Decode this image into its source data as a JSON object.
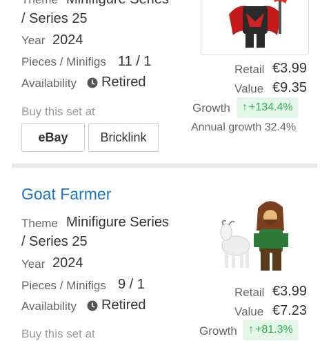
{
  "set1": {
    "theme_label": "Theme",
    "theme_value_line1": "Minifigure Series",
    "theme_value_line2": "/ Series 25",
    "year_label": "Year",
    "year_value": "2024",
    "pieces_label": "Pieces / Minifigs",
    "pieces_value": "11 / 1",
    "availability_label": "Availability",
    "availability_value": "Retired",
    "buy_label": "Buy this set at",
    "ebay_label": "eBay",
    "bricklink_label": "Bricklink",
    "retail_label": "Retail",
    "retail_value": "€3.99",
    "value_label": "Value",
    "value_value": "€9.35",
    "growth_label": "Growth",
    "growth_value": "+134.4%",
    "annual_growth": "Annual growth 32.4%"
  },
  "set2": {
    "title": "Goat Farmer",
    "theme_label": "Theme",
    "theme_value_line1": "Minifigure Series",
    "theme_value_line2": "/ Series 25",
    "year_label": "Year",
    "year_value": "2024",
    "pieces_label": "Pieces / Minifigs",
    "pieces_value": "9 / 1",
    "availability_label": "Availability",
    "availability_value": "Retired",
    "buy_label": "Buy this set at",
    "retail_label": "Retail",
    "retail_value": "€3.99",
    "value_label": "Value",
    "value_value": "€7.23",
    "growth_label": "Growth",
    "growth_value": "+81.3%"
  },
  "colors": {
    "link_blue": "#1a73c8",
    "growth_green": "#2bb04f",
    "growth_bg": "#e4f6e8"
  }
}
